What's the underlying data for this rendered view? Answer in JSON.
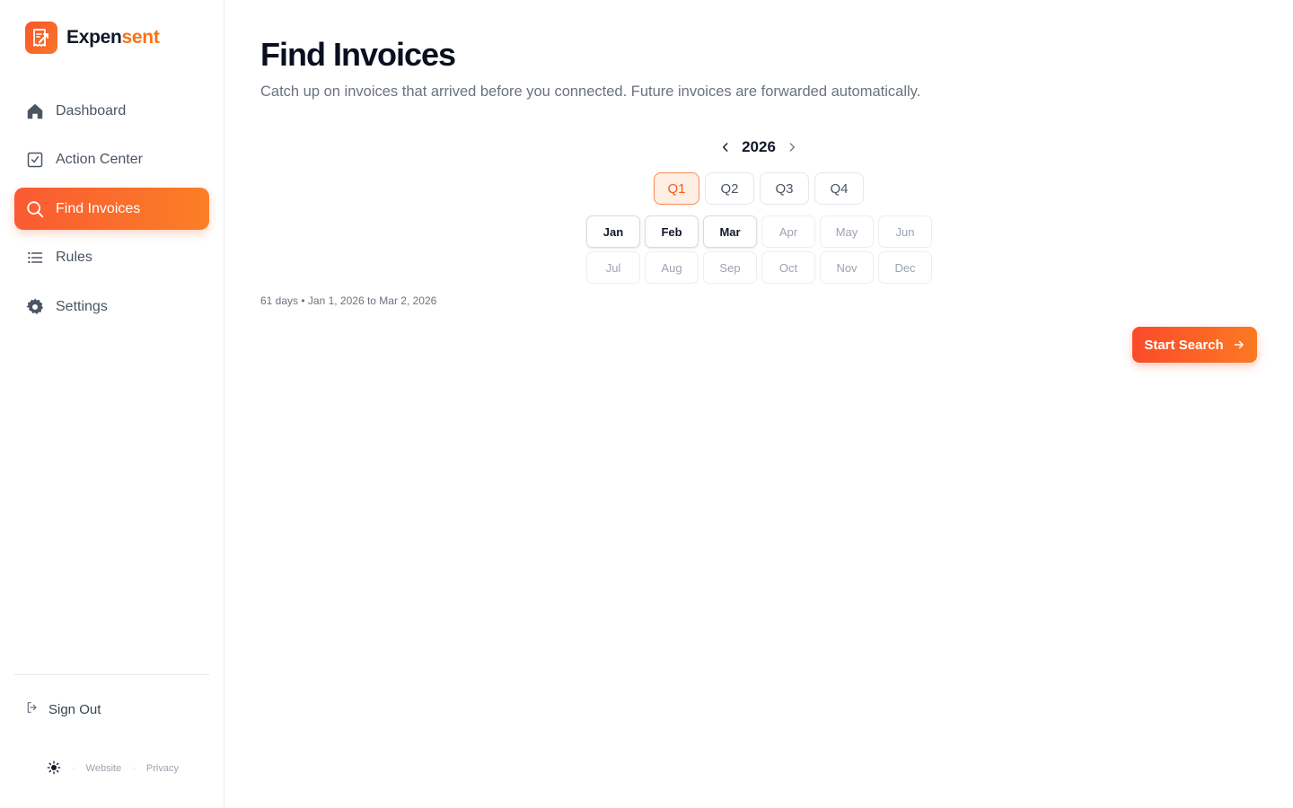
{
  "brand": {
    "name_part1": "Expen",
    "name_part2": "sent",
    "accent": "#f97316"
  },
  "sidebar": {
    "items": [
      {
        "label": "Dashboard",
        "icon": "home-icon",
        "active": false
      },
      {
        "label": "Action Center",
        "icon": "check-square-icon",
        "active": false
      },
      {
        "label": "Find Invoices",
        "icon": "search-icon",
        "active": true
      },
      {
        "label": "Rules",
        "icon": "list-icon",
        "active": false
      },
      {
        "label": "Settings",
        "icon": "gear-icon",
        "active": false
      }
    ],
    "sign_out": "Sign Out",
    "footer": {
      "website": "Website",
      "privacy": "Privacy",
      "theme_icon": "sun-icon"
    }
  },
  "main": {
    "title": "Find Invoices",
    "subtitle": "Catch up on invoices that arrived before you connected. Future invoices are forwarded automatically.",
    "year": "2026",
    "quarters": [
      {
        "label": "Q1",
        "active": true
      },
      {
        "label": "Q2",
        "active": false
      },
      {
        "label": "Q3",
        "active": false
      },
      {
        "label": "Q4",
        "active": false
      }
    ],
    "months": [
      {
        "label": "Jan",
        "selected": true
      },
      {
        "label": "Feb",
        "selected": true
      },
      {
        "label": "Mar",
        "selected": true
      },
      {
        "label": "Apr",
        "selected": false
      },
      {
        "label": "May",
        "selected": false
      },
      {
        "label": "Jun",
        "selected": false
      },
      {
        "label": "Jul",
        "selected": false
      },
      {
        "label": "Aug",
        "selected": false
      },
      {
        "label": "Sep",
        "selected": false
      },
      {
        "label": "Oct",
        "selected": false
      },
      {
        "label": "Nov",
        "selected": false
      },
      {
        "label": "Dec",
        "selected": false
      }
    ],
    "range_text": "61 days • Jan 1, 2026 to Mar 2, 2026",
    "start_button": "Start Search"
  },
  "colors": {
    "primary": "#f97316",
    "primary_gradient_start": "#fb4a2a",
    "quarter_active_bg": "#ffeee4"
  }
}
